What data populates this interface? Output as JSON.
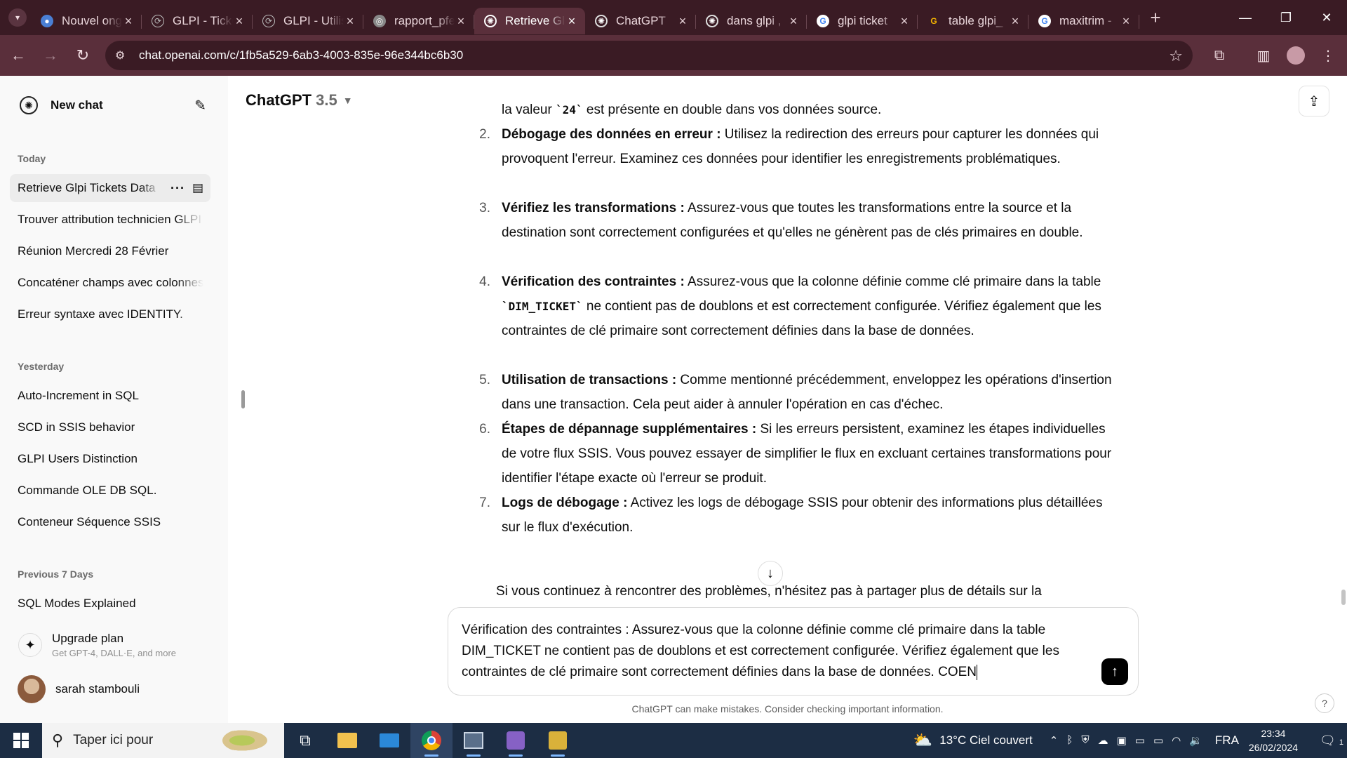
{
  "browser": {
    "tabs": [
      {
        "title": "Nouvel onglet",
        "active": false
      },
      {
        "title": "GLPI - Tickets",
        "active": false
      },
      {
        "title": "GLPI - Utilisateurs",
        "active": false
      },
      {
        "title": "rapport_pfe",
        "active": false
      },
      {
        "title": "Retrieve Glpi Tickets Data",
        "active": true
      },
      {
        "title": "ChatGPT",
        "active": false
      },
      {
        "title": "dans glpi , ",
        "active": false
      },
      {
        "title": "glpi ticket",
        "active": false
      },
      {
        "title": "table glpi_",
        "active": false
      },
      {
        "title": "maxitrim - ",
        "active": false
      }
    ],
    "url": "chat.openai.com/c/1fb5a529-6ab3-4003-835e-96e344bc6b30"
  },
  "sidebar": {
    "new_chat": "New chat",
    "groups": [
      {
        "label": "Today",
        "items": [
          "Retrieve Glpi Tickets Data",
          "Trouver attribution technicien GLPI",
          "Réunion Mercredi 28 Février",
          "Concaténer champs avec colonnes",
          "Erreur syntaxe avec IDENTITY."
        ]
      },
      {
        "label": "Yesterday",
        "items": [
          "Auto-Increment in SQL",
          "SCD in SSIS behavior",
          "GLPI Users Distinction",
          "Commande OLE DB SQL.",
          "Conteneur Séquence SSIS"
        ]
      },
      {
        "label": "Previous 7 Days",
        "items": [
          "SQL Modes Explained"
        ]
      }
    ],
    "upgrade_title": "Upgrade plan",
    "upgrade_sub": "Get GPT-4, DALL·E, and more",
    "user_name": "sarah stambouli"
  },
  "header": {
    "model": "ChatGPT",
    "version": "3.5"
  },
  "message": {
    "lead_in": {
      "text": "la valeur ",
      "code": "`24`",
      "after": " est présente en double dans vos données source."
    },
    "steps": [
      {
        "num": "2.",
        "title": "Débogage des données en erreur :",
        "text": " Utilisez la redirection des erreurs pour capturer les données qui provoquent l'erreur. Examinez ces données pour identifier les enregistrements problématiques."
      },
      {
        "num": "3.",
        "title": "Vérifiez les transformations :",
        "text": " Assurez-vous que toutes les transformations entre la source et la destination sont correctement configurées et qu'elles ne génèrent pas de clés primaires en double."
      },
      {
        "num": "4.",
        "title": "Vérification des contraintes :",
        "text_a": " Assurez-vous que la colonne définie comme clé primaire dans la table ",
        "code": "`DIM_TICKET`",
        "text_b": " ne contient pas de doublons et est correctement configurée. Vérifiez également que les contraintes de clé primaire sont correctement définies dans la base de données."
      },
      {
        "num": "5.",
        "title": "Utilisation de transactions :",
        "text": " Comme mentionné précédemment, enveloppez les opérations d'insertion dans une transaction. Cela peut aider à annuler l'opération en cas d'échec."
      },
      {
        "num": "6.",
        "title": "Étapes de dépannage supplémentaires :",
        "text": " Si les erreurs persistent, examinez les étapes individuelles de votre flux SSIS. Vous pouvez essayer de simplifier le flux en excluant certaines transformations pour identifier l'étape exacte où l'erreur se produit."
      },
      {
        "num": "7.",
        "title": "Logs de débogage :",
        "text": " Activez les logs de débogage SSIS pour obtenir des informations plus détaillées sur le flux d'exécution."
      }
    ],
    "closing": "Si vous continuez à rencontrer des problèmes, n'hésitez pas à partager plus de détails sur la"
  },
  "composer": {
    "value": "Vérification des contraintes : Assurez-vous que la colonne définie comme clé primaire dans la table DIM_TICKET ne contient pas de doublons et est correctement configurée. Vérifiez également que les contraintes de clé primaire sont correctement définies dans la base de données. COEN"
  },
  "disclaimer": "ChatGPT can make mistakes. Consider checking important information.",
  "taskbar": {
    "search_placeholder": "Taper ici pour",
    "weather": "13°C  Ciel couvert",
    "lang": "FRA",
    "time": "23:34",
    "date": "26/02/2024",
    "notif_count": "1"
  }
}
